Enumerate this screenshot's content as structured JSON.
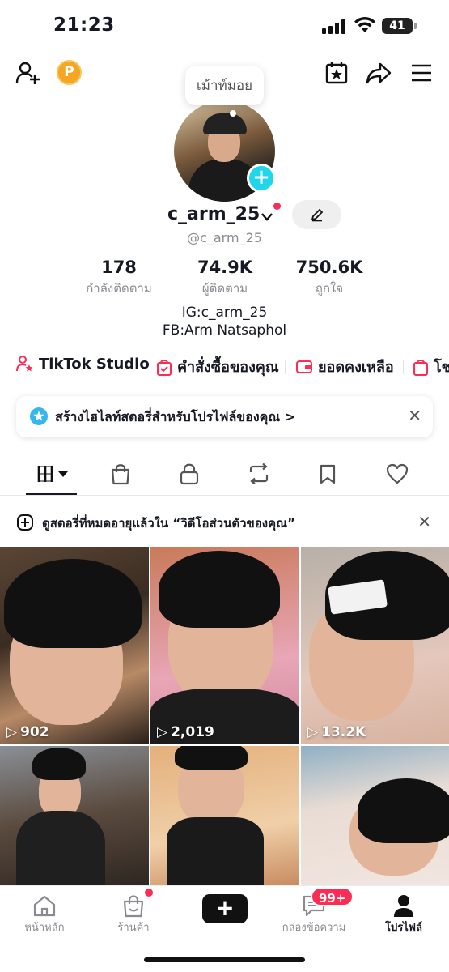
{
  "status_bar": {
    "time": "21:23",
    "battery": "41"
  },
  "profile": {
    "nickname_bubble": "เม้าท์มอย",
    "username": "c_arm_25",
    "handle": "@c_arm_25",
    "stats": [
      {
        "value": "178",
        "label": "กำลังติดตาม"
      },
      {
        "value": "74.9K",
        "label": "ผู้ติดตาม"
      },
      {
        "value": "750.6K",
        "label": "ถูกใจ"
      }
    ],
    "bio_line1": "IG:c_arm_25",
    "bio_line2": "FB:Arm Natsaphol"
  },
  "chips": [
    {
      "label": "TikTok Studio",
      "icon": "person-star-icon"
    },
    {
      "label": "คำสั่งซื้อของคุณ",
      "icon": "bag-check-icon"
    },
    {
      "label": "ยอดคงเหลือ",
      "icon": "wallet-icon"
    },
    {
      "label": "โช",
      "icon": "bag-icon"
    }
  ],
  "highlight_banner": {
    "text": "สร้างไฮไลท์สตอรี่สำหรับโปรไฟล์ของคุณ >"
  },
  "notice": {
    "text": "ดูสตอรี่ที่หมดอายุแล้วใน “วิดีโอส่วนตัวของคุณ”"
  },
  "videos": [
    {
      "views": "902"
    },
    {
      "views": "2,019"
    },
    {
      "views": "13.2K"
    },
    {
      "views": ""
    },
    {
      "views": ""
    },
    {
      "views": ""
    }
  ],
  "bottom_nav": {
    "home": "หน้าหลัก",
    "shop": "ร้านค้า",
    "create": "+",
    "inbox": "กล่องข้อความ",
    "inbox_badge": "99+",
    "profile": "โปรไฟล์"
  },
  "colors": {
    "accent": "#fe2c55",
    "cyan": "#25f4ee",
    "text": "#161823",
    "muted": "#8a8b91"
  }
}
